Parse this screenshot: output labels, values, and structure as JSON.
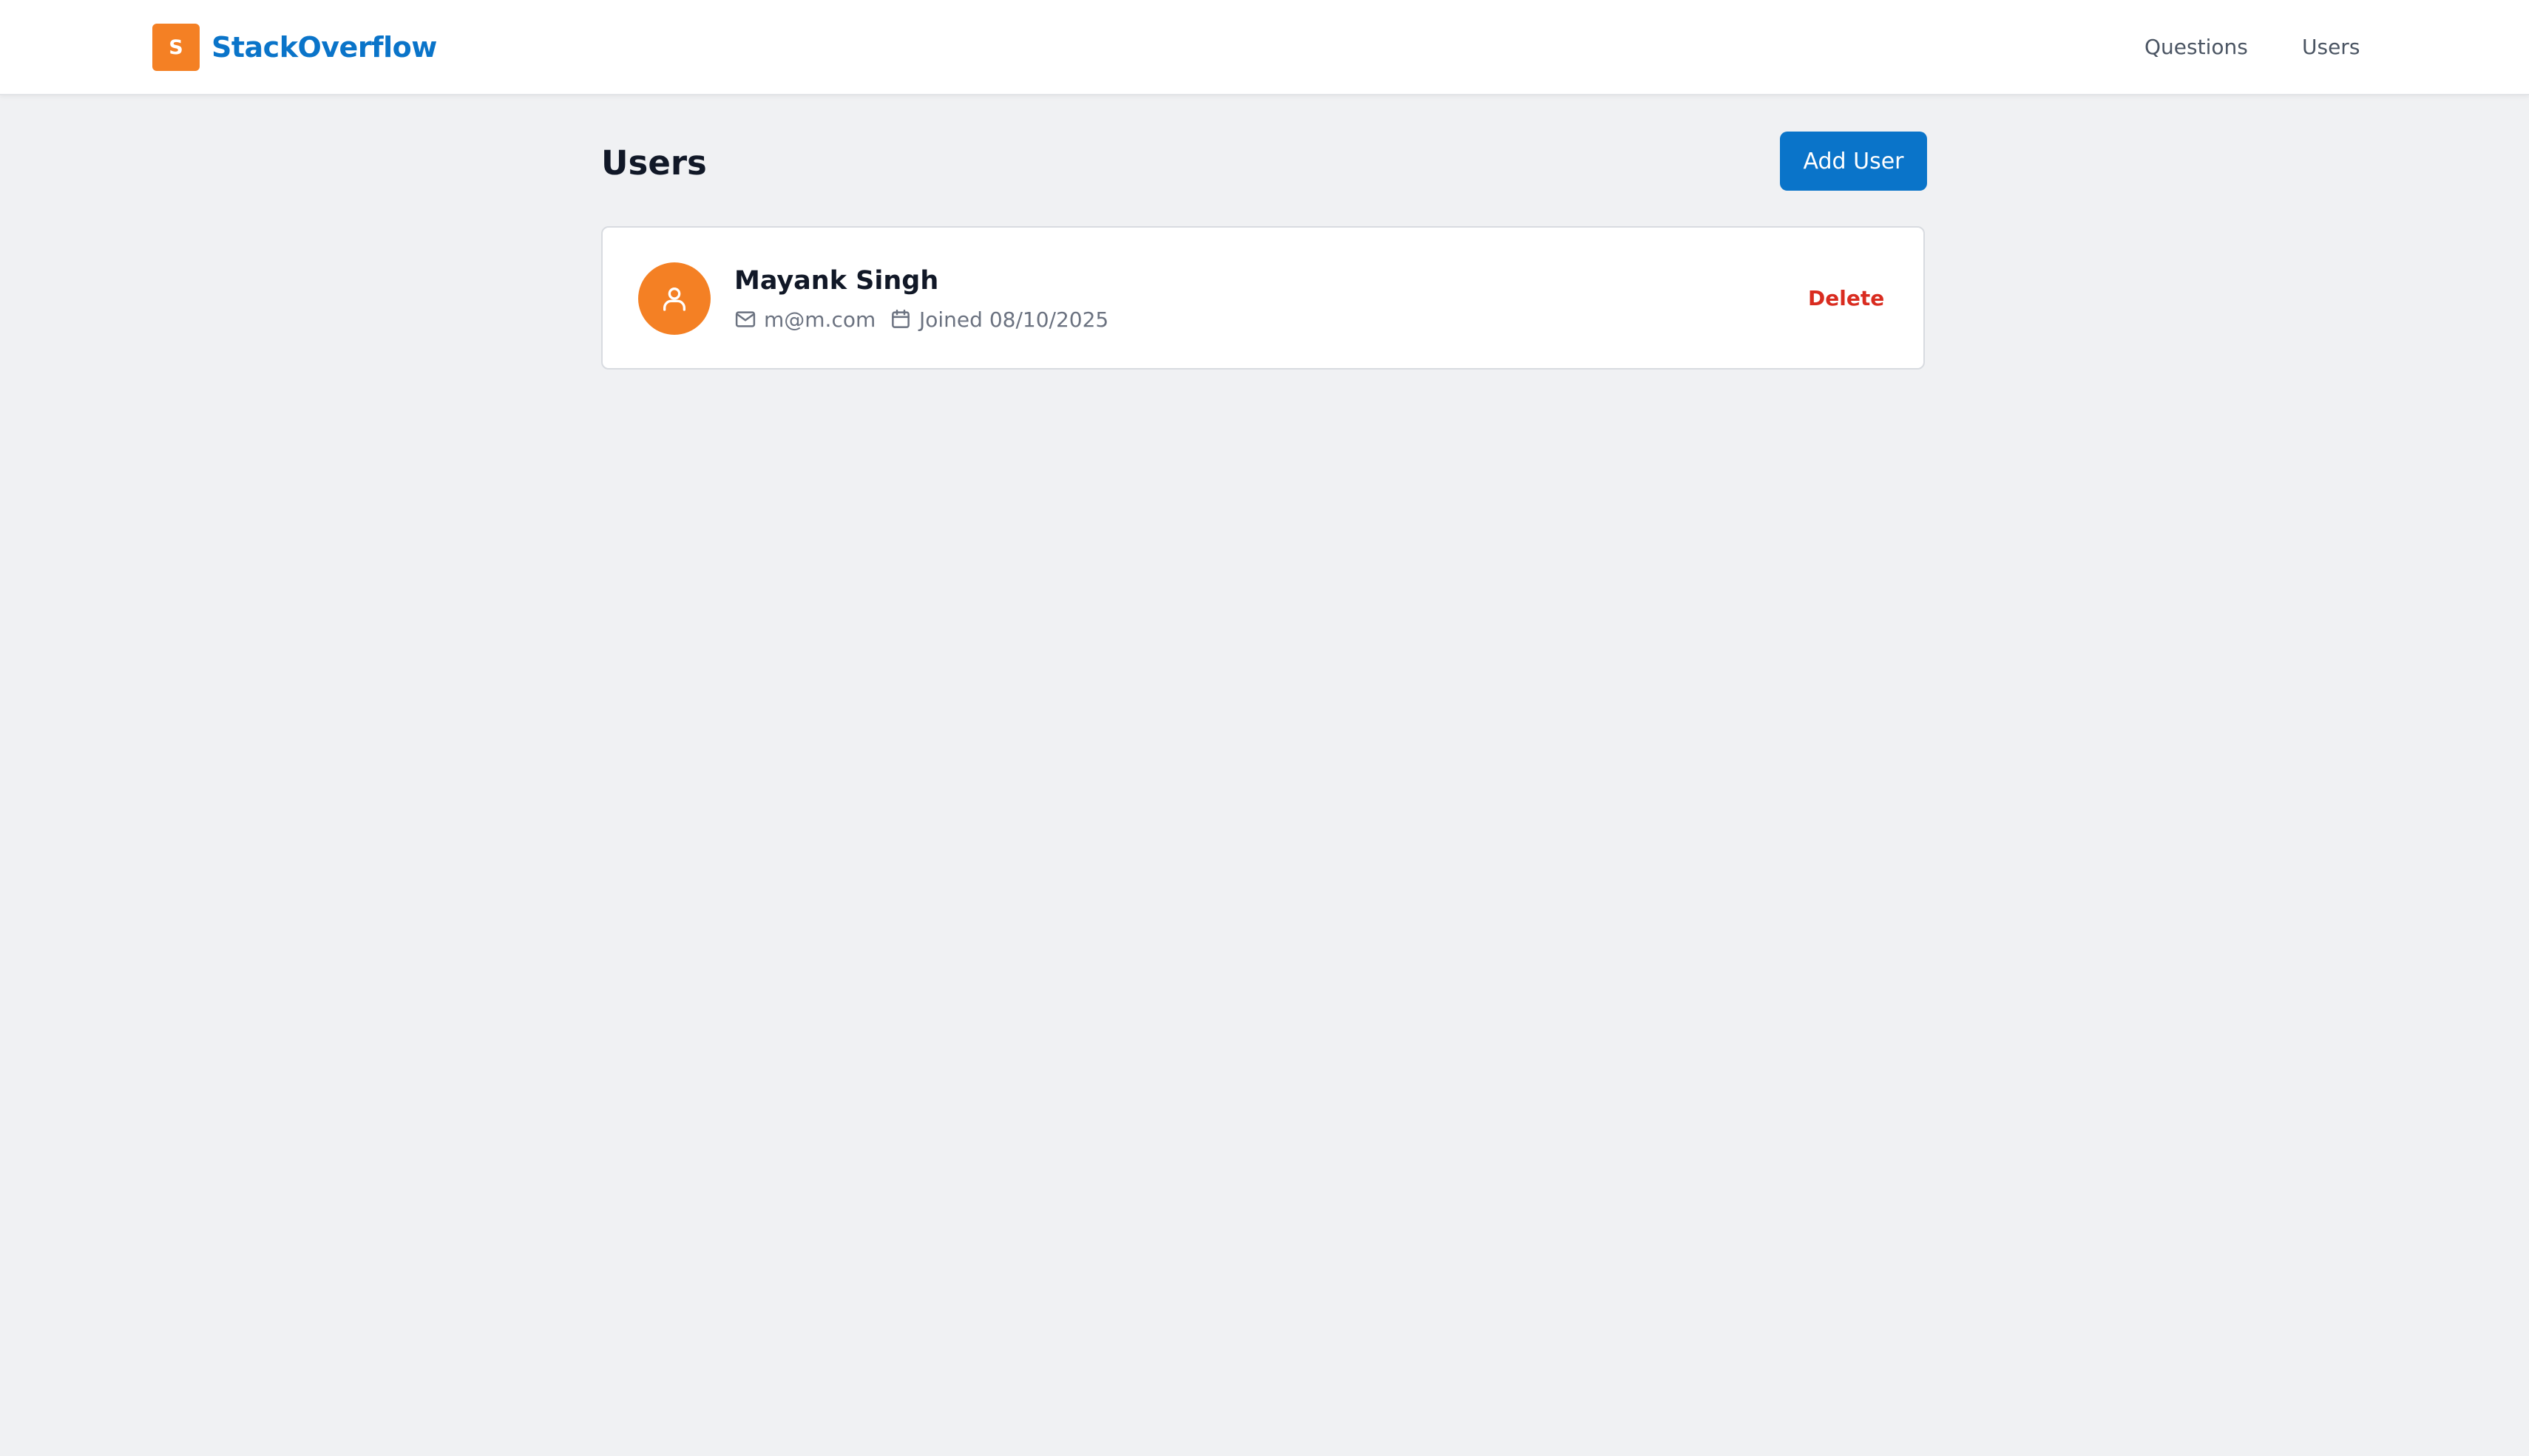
{
  "header": {
    "logo_letter": "S",
    "brand_name": "StackOverflow",
    "nav": {
      "questions": "Questions",
      "users": "Users"
    }
  },
  "page": {
    "title": "Users",
    "add_user_label": "Add User"
  },
  "users": [
    {
      "name": "Mayank Singh",
      "email": "m@m.com",
      "joined": "Joined 08/10/2025",
      "delete_label": "Delete"
    }
  ],
  "icons": {
    "avatar": "user-icon",
    "email": "mail-icon",
    "joined": "calendar-icon"
  },
  "colors": {
    "brand_orange": "#f48024",
    "brand_blue": "#0a74c9",
    "danger": "#d92c20",
    "background": "#f0f1f3"
  }
}
